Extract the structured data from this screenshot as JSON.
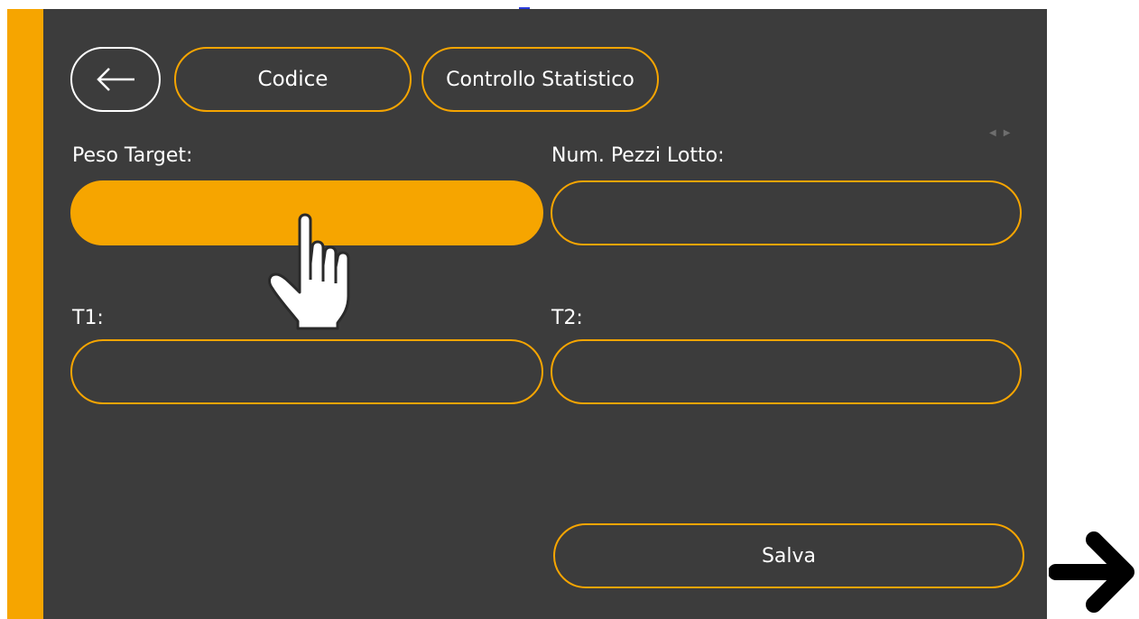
{
  "toolbar": {
    "back_icon": "arrow-left-icon",
    "tabs": [
      {
        "label": "Codice"
      },
      {
        "label": "Controllo Statistico"
      }
    ]
  },
  "form": {
    "fields": [
      {
        "label": "Peso Target:",
        "value": "",
        "active": true
      },
      {
        "label": "Num. Pezzi Lotto:",
        "value": ""
      },
      {
        "label": "T1:",
        "value": ""
      },
      {
        "label": "T2:",
        "value": ""
      }
    ],
    "save_label": "Salva"
  },
  "overlay": {
    "pointer_icon": "hand-pointer-icon",
    "next_icon": "arrow-right-icon"
  },
  "colors": {
    "accent": "#f6a500",
    "background": "#3c3c3c",
    "text": "#ffffff"
  }
}
